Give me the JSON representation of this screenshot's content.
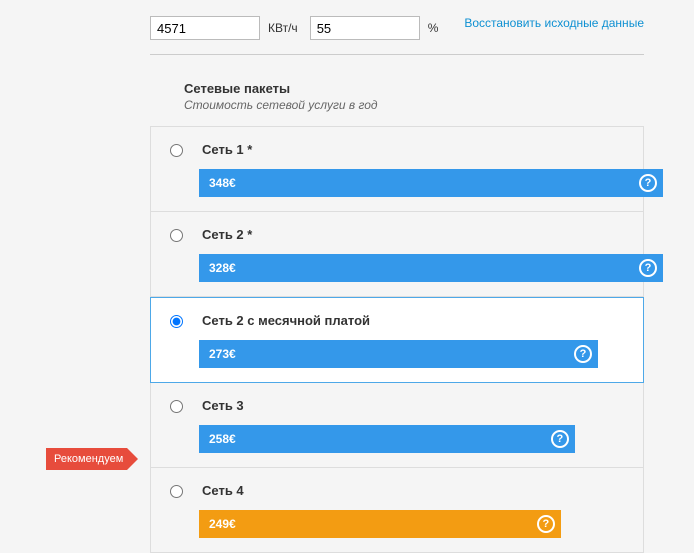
{
  "inputs": {
    "kwh_value": "4571",
    "kwh_unit": "КВт/ч",
    "pct_value": "55",
    "pct_unit": "%"
  },
  "reset_link": "Восстановить исходные данные",
  "section": {
    "title": "Сетевые пакеты",
    "subtitle": "Стоимость сетевой услуги в год"
  },
  "recommend_label": "Рекомендуем",
  "options": [
    {
      "label": "Сеть 1 *",
      "price": "348€",
      "color": "blue",
      "selected": false,
      "width": "100%"
    },
    {
      "label": "Сеть 2 *",
      "price": "328€",
      "color": "blue",
      "selected": false,
      "width": "100%"
    },
    {
      "label": "Сеть 2 с месячной платой",
      "price": "273€",
      "color": "blue",
      "selected": true,
      "width": "86%"
    },
    {
      "label": "Сеть 3",
      "price": "258€",
      "color": "blue",
      "selected": false,
      "width": "81%"
    },
    {
      "label": "Сеть 4",
      "price": "249€",
      "color": "orange",
      "selected": false,
      "width": "78%"
    }
  ]
}
